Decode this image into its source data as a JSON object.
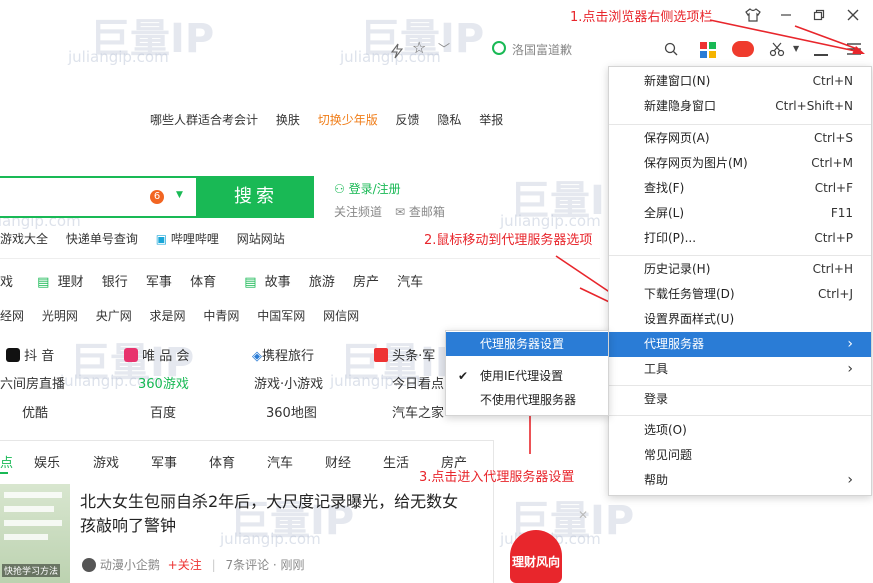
{
  "watermark": {
    "brand": "巨量IP",
    "domain": "juliangip.com"
  },
  "annotations": {
    "step1": "1.点击浏览器右侧选项栏",
    "step2": "2.鼠标移动到代理服务器选项",
    "step3": "3.点击进入代理服务器设置"
  },
  "address_bar": {
    "search_placeholder": "洛国富道歉"
  },
  "top_links": [
    "哪些人群适合考会计",
    "换肤",
    "切换少年版",
    "反馈",
    "隐私",
    "举报"
  ],
  "search": {
    "badge": "6",
    "button": "搜索",
    "login": "登录/注册",
    "follow": "关注频道",
    "mail": "查邮箱"
  },
  "quick_links": [
    "游戏大全",
    "快递单号查询",
    "哔哩哔哩",
    "网站网站"
  ],
  "categories": [
    "戏",
    "理财",
    "银行",
    "军事",
    "体育",
    "故事",
    "旅游",
    "房产",
    "汽车"
  ],
  "media_links": [
    "经网",
    "光明网",
    "央广网",
    "求是网",
    "中青网",
    "中国军网",
    "网信网"
  ],
  "apps_row1": [
    "抖 音",
    "唯 品 会",
    "携程旅行",
    "头条·军"
  ],
  "apps_row2": [
    "六间房直播",
    "360游戏",
    "游戏·小游戏",
    "今日看点"
  ],
  "apps_row3": [
    "优酷",
    "百度",
    "360地图",
    "汽车之家"
  ],
  "news_tabs": [
    "点",
    "娱乐",
    "游戏",
    "军事",
    "体育",
    "汽车",
    "财经",
    "生活",
    "房产"
  ],
  "news": {
    "headline": "北大女生包丽自杀2年后，大尺度记录曝光，给无数女孩敲响了警钟",
    "author": "动漫小企鹅",
    "follow": "+关注",
    "meta": "7条评论 · 刚刚",
    "thumb_caption": "快抢学习方法",
    "promo": "理财风向"
  },
  "menu": {
    "items": [
      {
        "label": "新建窗口(N)",
        "shortcut": "Ctrl+N"
      },
      {
        "label": "新建隐身窗口",
        "shortcut": "Ctrl+Shift+N"
      },
      {
        "label": "保存网页(A)",
        "shortcut": "Ctrl+S"
      },
      {
        "label": "保存网页为图片(M)",
        "shortcut": "Ctrl+M"
      },
      {
        "label": "查找(F)",
        "shortcut": "Ctrl+F"
      },
      {
        "label": "全屏(L)",
        "shortcut": "F11"
      },
      {
        "label": "打印(P)...",
        "shortcut": "Ctrl+P"
      },
      {
        "label": "历史记录(H)",
        "shortcut": "Ctrl+H"
      },
      {
        "label": "下载任务管理(D)",
        "shortcut": "Ctrl+J"
      },
      {
        "label": "设置界面样式(U)",
        "shortcut": ""
      },
      {
        "label": "代理服务器",
        "shortcut": "›"
      },
      {
        "label": "工具",
        "shortcut": "›"
      },
      {
        "label": "登录",
        "shortcut": ""
      },
      {
        "label": "选项(O)",
        "shortcut": ""
      },
      {
        "label": "常见问题",
        "shortcut": ""
      },
      {
        "label": "帮助",
        "shortcut": "›"
      }
    ]
  },
  "submenu": {
    "items": [
      "代理服务器设置",
      "使用IE代理设置",
      "不使用代理服务器"
    ],
    "check": "✔"
  },
  "colors": {
    "accent": "#19b955",
    "highlight": "#2a7cd6",
    "annotation": "#e8262c"
  }
}
